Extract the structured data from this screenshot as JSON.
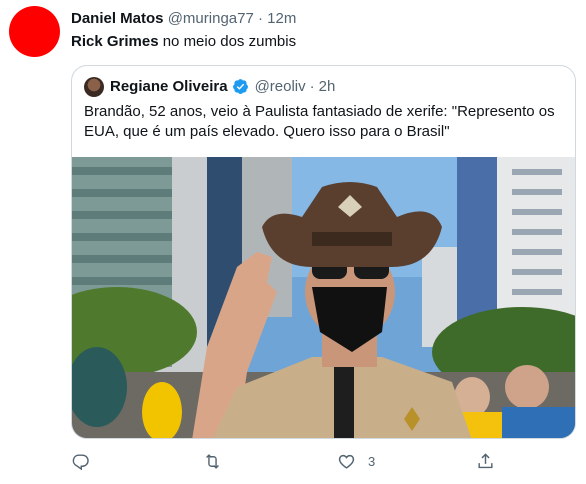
{
  "tweet": {
    "author_name": "Daniel Matos",
    "author_handle": "@muringa77",
    "separator": "·",
    "time": "12m",
    "text_bold": "Rick Grimes",
    "text_rest": " no meio dos zumbis",
    "avatar_color": "#ff0000"
  },
  "quoted": {
    "author_name": "Regiane Oliveira",
    "author_handle": "@reoliv",
    "separator": "·",
    "time": "2h",
    "verified": true,
    "verified_color": "#1d9bf0",
    "text": "Brandão, 52 anos, veio à Paulista fantasiado de xerife: \"Represento os EUA, que é um país elevado. Quero isso para o Brasil\"",
    "media_icon": "photo-sheriff-costume-icon"
  },
  "actions": {
    "reply_icon": "reply-icon",
    "retweet_icon": "retweet-icon",
    "like_icon": "heart-icon",
    "like_count": "3",
    "share_icon": "share-icon"
  }
}
